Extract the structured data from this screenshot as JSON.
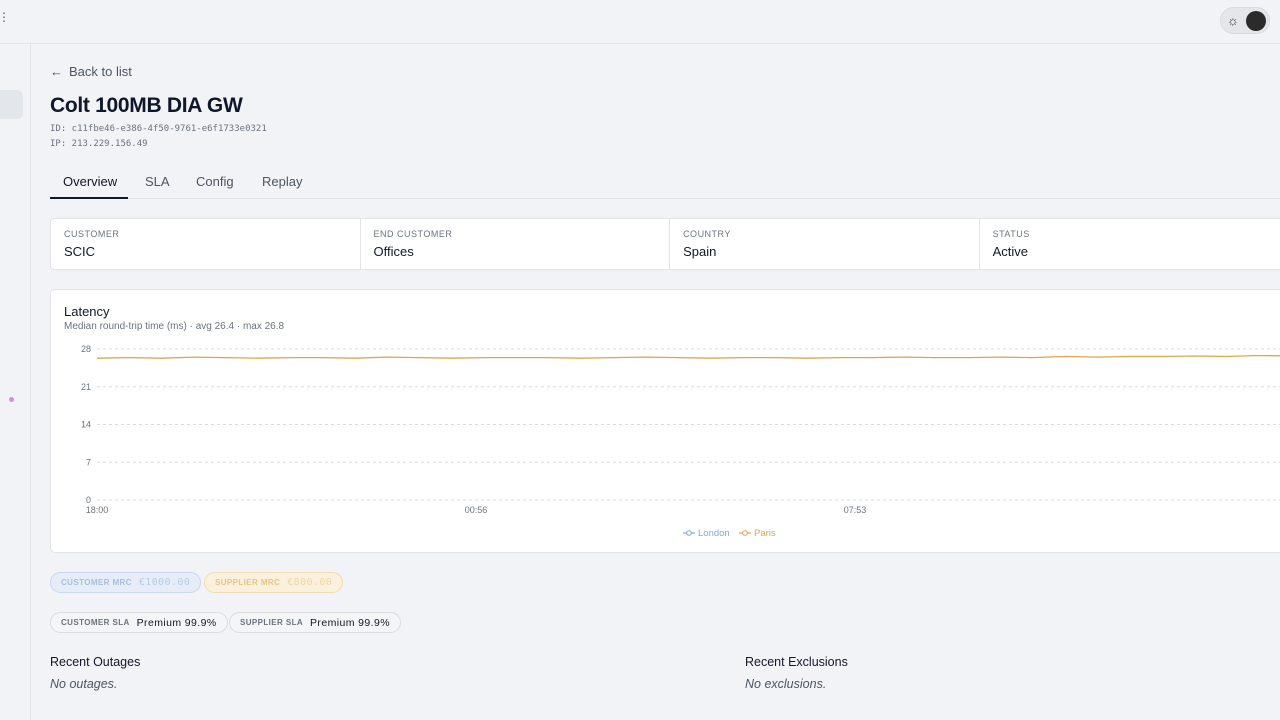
{
  "header": {
    "kebab_icon": "vertical-dots-icon",
    "theme_toggle": {
      "sun_icon": "sun-icon",
      "knob_icon": "dark-mode-knob"
    }
  },
  "back_link": {
    "label": "Back to list",
    "icon": "arrow-left-icon"
  },
  "circuit": {
    "name": "Colt 100MB DIA GW",
    "id": "ID: c11fbe46-e386-4f50-9761-e6f1733e0321",
    "ip": "IP: 213.229.156.49"
  },
  "tabs": [
    {
      "label": "Overview",
      "active": true
    },
    {
      "label": "SLA",
      "active": false
    },
    {
      "label": "Config",
      "active": false
    },
    {
      "label": "Replay",
      "active": false
    }
  ],
  "info": [
    {
      "label": "CUSTOMER",
      "value": "SCIC"
    },
    {
      "label": "END CUSTOMER",
      "value": "Offices"
    },
    {
      "label": "COUNTRY",
      "value": "Spain"
    },
    {
      "label": "STATUS",
      "value": "Active"
    }
  ],
  "chart_data": {
    "type": "line",
    "title": "Latency",
    "subtitle": "Median round-trip time (ms) · avg 26.4 · max 26.8",
    "xlabel": "",
    "ylabel": "",
    "ylim": [
      0,
      28
    ],
    "y_ticks": [
      "28",
      "21",
      "14",
      "7",
      "0"
    ],
    "x_ticks": [
      "18:00",
      "00:56",
      "07:53"
    ],
    "grid": true,
    "legend_position": "bottom-center",
    "series": [
      {
        "name": "London",
        "color": "#7fa7e0",
        "values": []
      },
      {
        "name": "Paris",
        "color": "#e0a44a",
        "values": [
          26.3,
          26.4,
          26.3,
          26.5,
          26.4,
          26.3,
          26.4,
          26.4,
          26.3,
          26.5,
          26.4,
          26.3,
          26.4,
          26.4,
          26.4,
          26.3,
          26.4,
          26.5,
          26.4,
          26.3,
          26.4,
          26.4,
          26.3,
          26.4,
          26.4,
          26.5,
          26.4,
          26.4,
          26.5,
          26.4,
          26.6,
          26.5,
          26.6,
          26.6,
          26.7,
          26.6,
          26.8,
          26.7
        ]
      }
    ]
  },
  "pills": {
    "customer_mrc": {
      "label": "CUSTOMER MRC",
      "value": "€1000.00"
    },
    "supplier_mrc": {
      "label": "SUPPLIER MRC",
      "value": "€800.00"
    },
    "customer_sla": {
      "label": "CUSTOMER SLA",
      "value": "Premium 99.9%"
    },
    "supplier_sla": {
      "label": "SUPPLIER SLA",
      "value": "Premium 99.9%"
    }
  },
  "outages": {
    "title": "Recent Outages",
    "empty": "No outages."
  },
  "exclusions": {
    "title": "Recent Exclusions",
    "empty": "No exclusions."
  }
}
